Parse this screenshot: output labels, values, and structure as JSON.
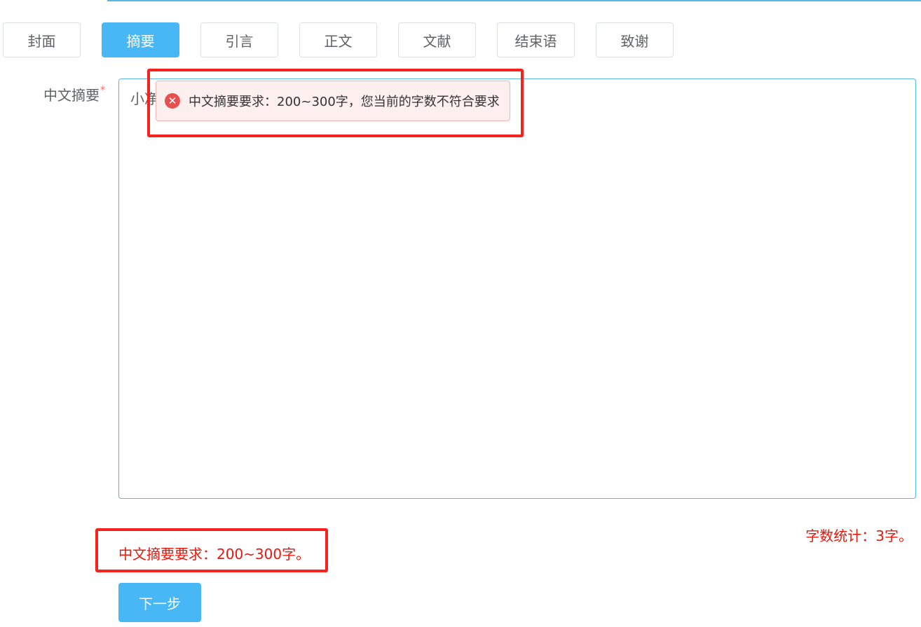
{
  "tabs": [
    {
      "label": "封面",
      "active": false
    },
    {
      "label": "摘要",
      "active": true
    },
    {
      "label": "引言",
      "active": false
    },
    {
      "label": "正文",
      "active": false
    },
    {
      "label": "文献",
      "active": false
    },
    {
      "label": "结束语",
      "active": false
    },
    {
      "label": "致谢",
      "active": false
    }
  ],
  "form": {
    "label": "中文摘要",
    "required_mark": "*",
    "value": "小净"
  },
  "toast": {
    "icon": "error-circle-icon",
    "message": "中文摘要要求：200~300字，您当前的字数不符合要求"
  },
  "hint": "中文摘要要求：200~300字。",
  "word_count": "字数统计：3字。",
  "next_button": "下一步",
  "colors": {
    "accent": "#47b8f5",
    "error": "#e8180c",
    "annotation": "#f5221e"
  }
}
